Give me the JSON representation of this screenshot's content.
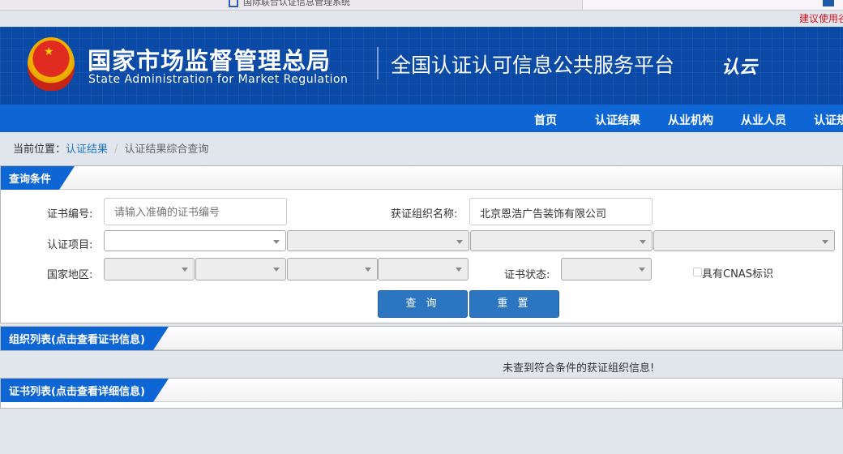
{
  "browser": {
    "tab1": "国际联合认证信息管理系统",
    "notice": "建议使用谷歌浏览器"
  },
  "header": {
    "org_cn": "国家市场监督管理总局",
    "org_en": "State Administration  for  Market Regulation",
    "platform": "全国认证认可信息公共服务平台",
    "logo_text": "认云"
  },
  "nav": [
    "首页",
    "认证结果",
    "从业机构",
    "从业人员",
    "认证规则"
  ],
  "breadcrumb": {
    "label": "当前位置：",
    "link": "认证结果",
    "current": "认证结果综合查询"
  },
  "query": {
    "title": "查询条件",
    "cert_no_label": "证书编号:",
    "cert_no_placeholder": "请输入准确的证书编号",
    "org_label": "获证组织名称:",
    "org_value": "北京恩浩广告装饰有限公司",
    "project_label": "认证项目:",
    "region_label": "国家地区:",
    "status_label": "证书状态:",
    "cnas_label": "具有CNAS标识",
    "search_btn": "查 询",
    "reset_btn": "重 置"
  },
  "org_list": {
    "title": "组织列表(点击查看证书信息)",
    "empty": "未查到符合条件的获证组织信息!"
  },
  "cert_list": {
    "title": "证书列表(点击查看详细信息)"
  }
}
